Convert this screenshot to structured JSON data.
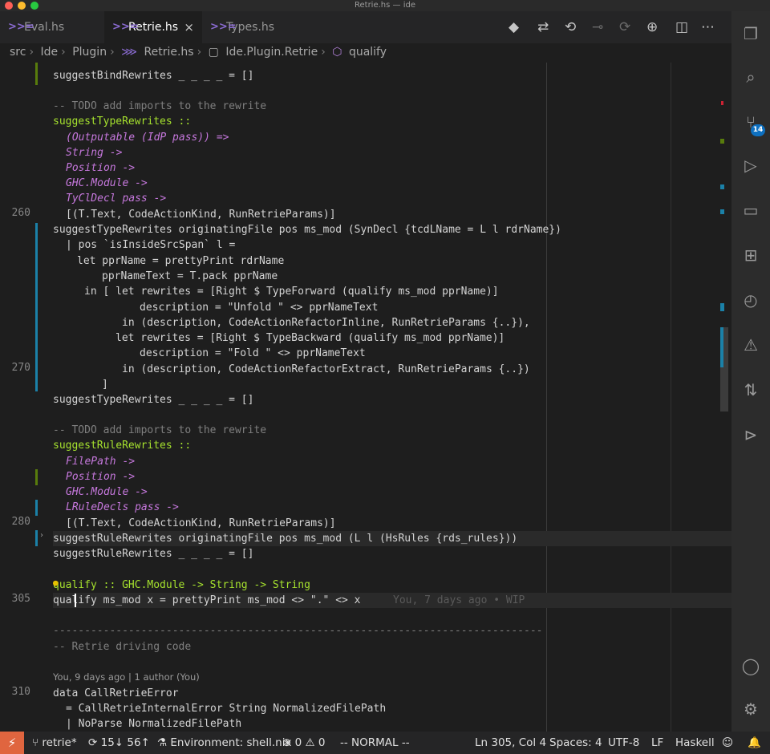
{
  "window": {
    "title": "Retrie.hs — ide"
  },
  "tabs": [
    {
      "label": "Eval.hs",
      "icon": ">>="
    },
    {
      "label": "Retrie.hs",
      "icon": ">>=",
      "close": "×"
    },
    {
      "label": "Types.hs",
      "icon": ">>="
    }
  ],
  "breadcrumb": {
    "items": [
      "src",
      "Ide",
      "Plugin",
      "Retrie.hs",
      "Ide.Plugin.Retrie",
      "qualify"
    ],
    "separator": "›"
  },
  "gutter": {
    "line_numbers": [
      {
        "n": "260",
        "row": 9
      },
      {
        "n": "270",
        "row": 20
      },
      {
        "n": "280",
        "row": 30
      },
      {
        "n": "305",
        "row": 35
      },
      {
        "n": "310",
        "row": 41
      }
    ]
  },
  "editor": {
    "lines": {
      "l0": "suggestBindRewrites _ _ _ _ = []",
      "l2": "-- TODO add imports to the rewrite",
      "l3": "suggestTypeRewrites ::",
      "l4": "(Outputable (IdP pass)) =>",
      "l5": "String ->",
      "l6": "Position ->",
      "l7": "GHC.Module ->",
      "l8": "TyClDecl pass ->",
      "l9": "[(T.Text, CodeActionKind, RunRetrieParams)]",
      "l10": "suggestTypeRewrites originatingFile pos ms_mod (SynDecl {tcdLName = L l rdrName})",
      "l11": "| pos `isInsideSrcSpan` l =",
      "l12": "let pprName = prettyPrint rdrName",
      "l13": "pprNameText = T.pack pprName",
      "l14": "in [ let rewrites = [Right $ TypeForward (qualify ms_mod pprName)]",
      "l15": "description = \"Unfold \" <> pprNameText",
      "l16": "in (description, CodeActionRefactorInline, RunRetrieParams {..}),",
      "l17": "let rewrites = [Right $ TypeBackward (qualify ms_mod pprName)]",
      "l18": "description = \"Fold \" <> pprNameText",
      "l19": "in (description, CodeActionRefactorExtract, RunRetrieParams {..})",
      "l20": "]",
      "l21": "suggestTypeRewrites _ _ _ _ = []",
      "l23": "-- TODO add imports to the rewrite",
      "l24": "suggestRuleRewrites ::",
      "l25": "FilePath ->",
      "l26": "Position ->",
      "l27": "GHC.Module ->",
      "l28": "LRuleDecls pass ->",
      "l29": "[(T.Text, CodeActionKind, RunRetrieParams)]",
      "l30": "suggestRuleRewrites originatingFile pos ms_mod (L l (HsRules {rds_rules}))",
      "l31": "suggestRuleRewrites _ _ _ _ = []",
      "l33": "qualify :: GHC.Module -> String -> String",
      "l34": "qualify ms_mod x = prettyPrint ms_mod <> \".\" <> x",
      "l34_blame": "You, 7 days ago • WIP",
      "l36": "------------------------------------------------------------------------------------------------",
      "l37": "-- Retrie driving code",
      "codelens": "You, 9 days ago | 1 author (You)",
      "l40": "data CallRetrieError",
      "l41": "= CallRetrieInternalError String NormalizedFilePath",
      "l42": "| NoParse NormalizedFilePath"
    }
  },
  "activity": {
    "scm_badge": "14"
  },
  "statusbar": {
    "branch": "retrie*",
    "sync": "15↓ 56↑",
    "environment": "Environment: shell.nix",
    "problems": "⊗ 0 ⚠ 0",
    "mode": "-- NORMAL --",
    "position": "Ln 305, Col 4",
    "spaces": "Spaces: 4",
    "encoding": "UTF-8",
    "eol": "LF",
    "language": "Haskell"
  },
  "colors": {
    "accent": "#0e70c0",
    "remote": "#e0653f",
    "keyword": "#e535ab",
    "function": "#a6e22e",
    "type": "#c678dd",
    "string": "#e6db74"
  }
}
